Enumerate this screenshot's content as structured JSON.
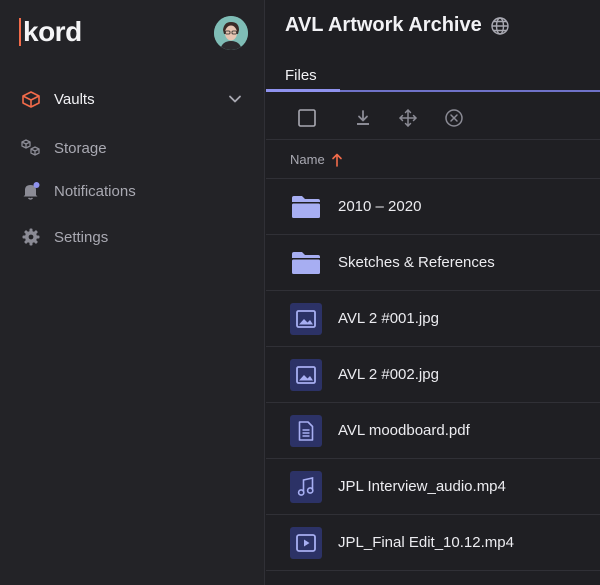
{
  "app": {
    "logo_text": "kord"
  },
  "sidebar": {
    "items": [
      {
        "label": "Vaults",
        "icon": "vault-box-icon",
        "active": true
      },
      {
        "label": "Storage",
        "icon": "storage-cubes-icon"
      },
      {
        "label": "Notifications",
        "icon": "bell-icon"
      },
      {
        "label": "Settings",
        "icon": "gear-icon"
      }
    ]
  },
  "main": {
    "title": "AVL Artwork Archive",
    "tabs": [
      {
        "label": "Files"
      }
    ],
    "column_header": "Name",
    "files": [
      {
        "name": "2010 – 2020",
        "type": "folder"
      },
      {
        "name": "Sketches & References",
        "type": "folder"
      },
      {
        "name": "AVL 2 #001.jpg",
        "type": "image"
      },
      {
        "name": "AVL 2 #002.jpg",
        "type": "image"
      },
      {
        "name": "AVL moodboard.pdf",
        "type": "document"
      },
      {
        "name": "JPL Interview_audio.mp4",
        "type": "audio"
      },
      {
        "name": "JPL_Final Edit_10.12.mp4",
        "type": "video"
      }
    ]
  },
  "colors": {
    "accent": "#f26b4a",
    "primary": "#8f92ee",
    "background": "#1f1f23",
    "sidebar": "#232327"
  }
}
